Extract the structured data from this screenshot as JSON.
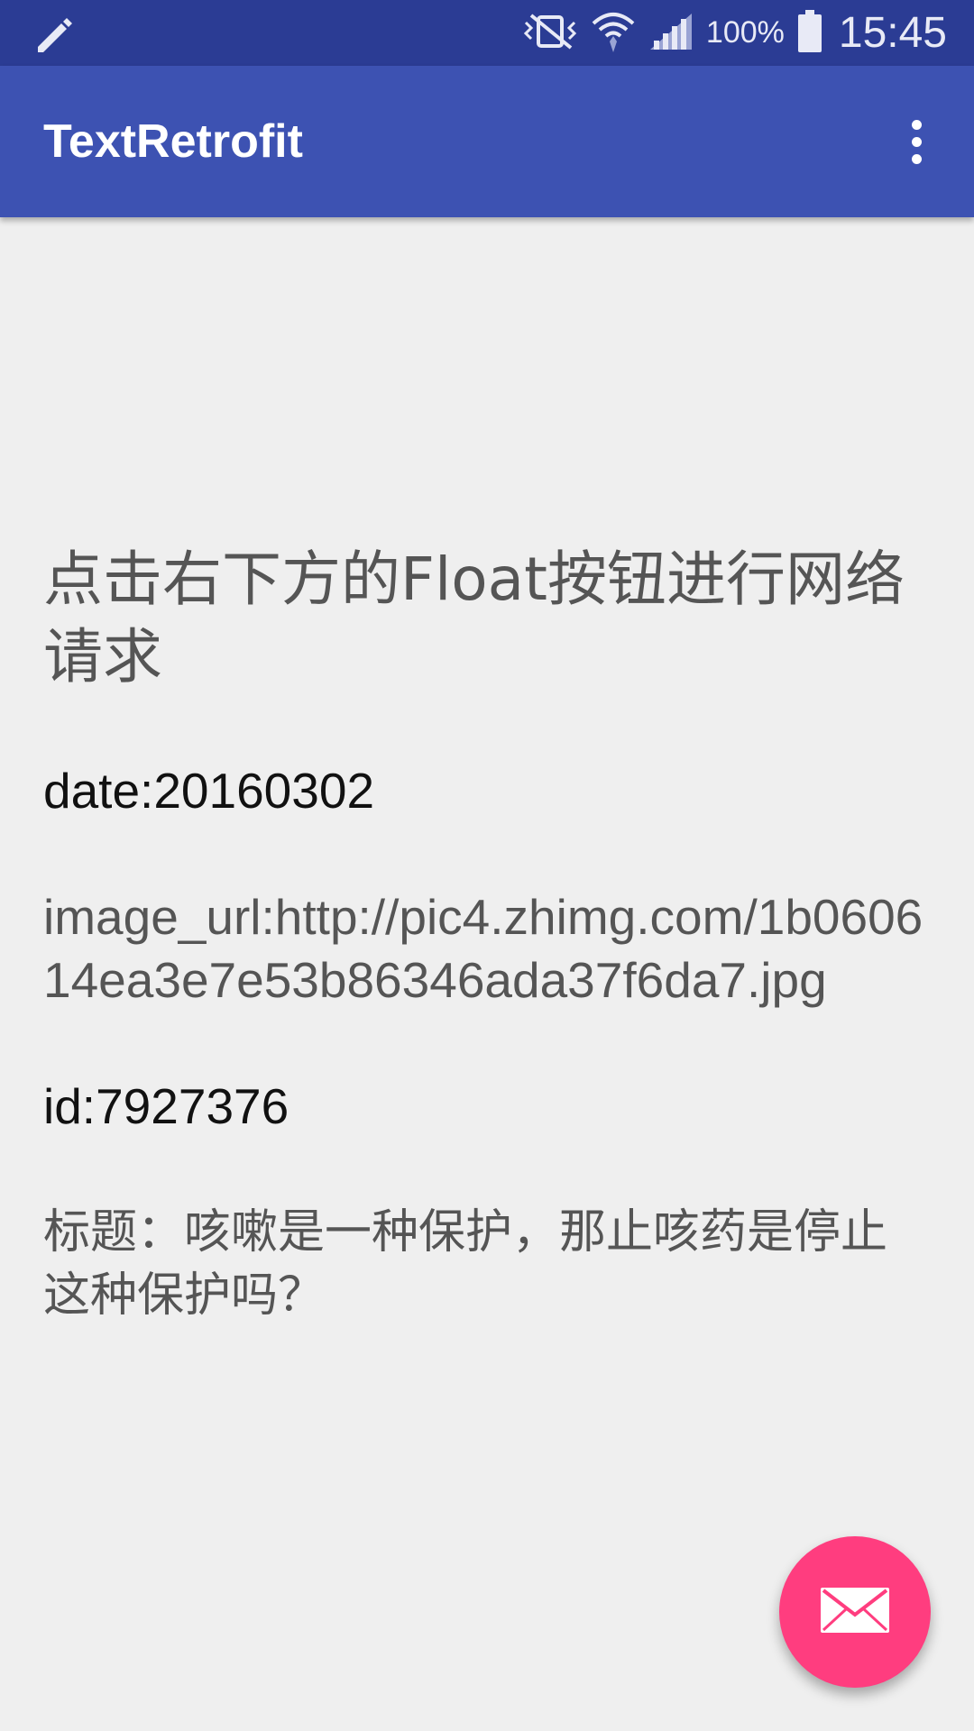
{
  "status_bar": {
    "battery_percent": "100%",
    "time": "15:45",
    "background_color": "#2b3c94",
    "icons": [
      "edit-icon",
      "vibrate-icon",
      "wifi-icon",
      "signal-icon",
      "battery-icon"
    ]
  },
  "app_bar": {
    "title": "TextRetrofit",
    "background_color": "#3d52b2",
    "overflow_icon": "more-vert-icon"
  },
  "content": {
    "hint": "点击右下方的Float按钮进行网络请求",
    "date": "date:20160302",
    "image_url": "image_url:http://pic4.zhimg.com/1b060614ea3e7e53b86346ada37f6da7.jpg",
    "id": "id:7927376",
    "title": "标题：咳嗽是一种保护，那止咳药是停止这种保护吗？"
  },
  "fab": {
    "icon": "mail-icon",
    "color": "#ff3d7f"
  }
}
